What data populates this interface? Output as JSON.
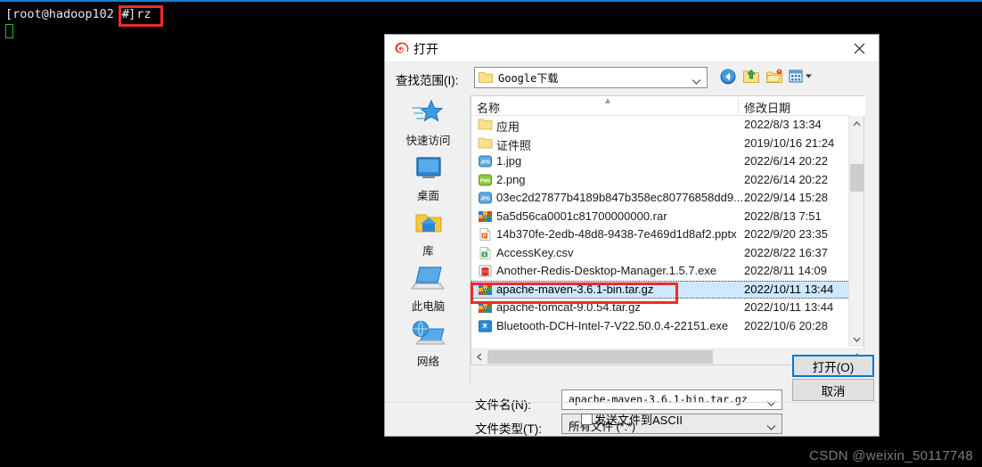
{
  "terminal": {
    "prompt": "[root@hadoop102 ~]",
    "command": "# rz",
    "cursor": "block-cursor"
  },
  "watermark": "CSDN @weixin_50117748",
  "dialog": {
    "title": "打开",
    "title_icon": "xshell-spiral-icon",
    "close_label": "✕",
    "lookin": {
      "label": "查找范围(I):",
      "value": "Google下载",
      "folder_icon": "folder-icon",
      "caret_icon": "chevron-down-icon"
    },
    "toolbar": [
      {
        "name": "back-button",
        "icon": "back-arrow-icon"
      },
      {
        "name": "up-one-level-button",
        "icon": "folder-up-arrow-icon"
      },
      {
        "name": "new-folder-button",
        "icon": "new-folder-icon"
      },
      {
        "name": "views-button",
        "icon": "views-grid-icon"
      }
    ],
    "places": [
      {
        "label": "快速访问",
        "icon": "quick-access-star-icon"
      },
      {
        "label": "桌面",
        "icon": "desktop-monitor-icon"
      },
      {
        "label": "库",
        "icon": "library-folder-icon"
      },
      {
        "label": "此电脑",
        "icon": "this-pc-icon"
      },
      {
        "label": "网络",
        "icon": "network-globe-icon"
      }
    ],
    "columns": {
      "name": "名称",
      "date": "修改日期"
    },
    "files": [
      {
        "name": "应用",
        "date": "2022/8/3 13:34",
        "icon": "folder",
        "selected": false
      },
      {
        "name": "证件照",
        "date": "2019/10/16 21:24",
        "icon": "folder",
        "selected": false
      },
      {
        "name": "1.jpg",
        "date": "2022/6/14 20:22",
        "icon": "jpg",
        "selected": false
      },
      {
        "name": "2.png",
        "date": "2022/6/14 20:22",
        "icon": "png",
        "selected": false
      },
      {
        "name": "03ec2d27877b4189b847b358ec80776858dd9...",
        "date": "2022/9/14 15:28",
        "icon": "jpg",
        "selected": false
      },
      {
        "name": "5a5d56ca0001c81700000000.rar",
        "date": "2022/8/13 7:51",
        "icon": "rar",
        "selected": false
      },
      {
        "name": "14b370fe-2edb-48d8-9438-7e469d1d8af2.pptx",
        "date": "2022/9/20 23:35",
        "icon": "pptx",
        "selected": false
      },
      {
        "name": "AccessKey.csv",
        "date": "2022/8/22 16:37",
        "icon": "csv",
        "selected": false
      },
      {
        "name": "Another-Redis-Desktop-Manager.1.5.7.exe",
        "date": "2022/8/11 14:09",
        "icon": "exe-redis",
        "selected": false
      },
      {
        "name": "apache-maven-3.6.1-bin.tar.gz",
        "date": "2022/10/11 13:44",
        "icon": "rar",
        "selected": true
      },
      {
        "name": "apache-tomcat-9.0.54.tar.gz",
        "date": "2022/10/11 13:44",
        "icon": "rar",
        "selected": false
      },
      {
        "name": "Bluetooth-DCH-Intel-7-V22.50.0.4-22151.exe",
        "date": "2022/10/6 20:28",
        "icon": "exe-blue",
        "selected": false
      }
    ],
    "filename": {
      "label": "文件名(N):",
      "value": "apache-maven-3.6.1-bin.tar.gz"
    },
    "filetype": {
      "label": "文件类型(T):",
      "value": "所有文件 (*.*)"
    },
    "buttons": {
      "open": "打开(O)",
      "cancel": "取消"
    },
    "ascii_checkbox": {
      "label": "发送文件到ASCII",
      "checked": false
    },
    "scroll": {
      "up_arrow": "chevron-up-icon",
      "down_arrow": "chevron-down-icon",
      "left_arrow": "chevron-left-icon",
      "right_arrow": "chevron-right-icon"
    }
  },
  "annotations": {
    "accent_red": "#ef2b2b",
    "selection_blue": "#cde8ff",
    "focus_blue": "#0078d7"
  }
}
